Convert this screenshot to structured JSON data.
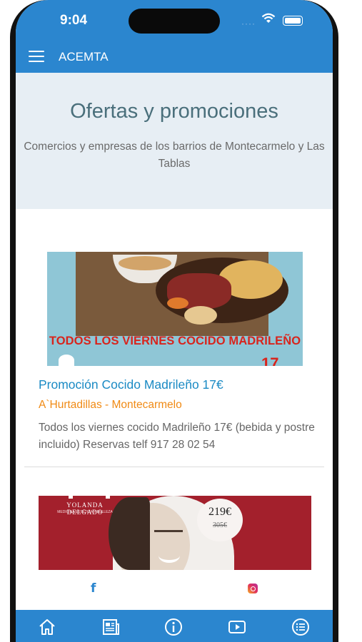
{
  "status_bar": {
    "time": "9:04"
  },
  "app_bar": {
    "title": "ACEMTA"
  },
  "hero": {
    "title": "Ofertas y promociones",
    "subtitle": "Comercios y empresas de los barrios de Montecarmelo y Las Tablas"
  },
  "offers": [
    {
      "image_text": "TODOS LOS VIERNES COCIDO MADRILEÑO",
      "image_price_partial": "17",
      "title": "Promoción Cocido Madrileño 17€",
      "business": "A`Hurtadillas - Montecarmelo",
      "description": "Todos los viernes cocido Madrileño 17€ (bebida y postre incluido) Reservas telf 917 28 02 54"
    },
    {
      "image_brand": "YOLANDA DELGADO",
      "image_brand_sub": "MEDICINA ESTÉTICA Y BELLEZA",
      "image_price_new": "219€",
      "image_price_old": "305€"
    }
  ],
  "social": {
    "facebook": "f"
  },
  "tabs": [
    {
      "name": "home"
    },
    {
      "name": "news"
    },
    {
      "name": "info"
    },
    {
      "name": "video"
    },
    {
      "name": "list"
    }
  ],
  "colors": {
    "primary": "#2b86cf",
    "title": "#1a8ac4",
    "subtitle": "#f08a14",
    "hero_bg": "#e7eef4"
  }
}
